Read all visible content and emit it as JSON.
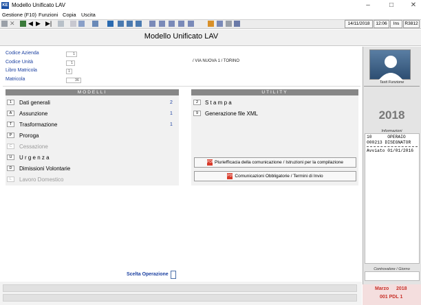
{
  "window": {
    "title": "Modello Unificato LAV",
    "icon_text": "KE"
  },
  "menu": [
    "Gestione (F10)",
    "Funzioni",
    "Copia",
    "Uscita"
  ],
  "status": {
    "date": "14/11/2018",
    "time": "12:06",
    "mode": "Ins",
    "code": "R3812"
  },
  "header": {
    "title": "Modello Unificato LAV"
  },
  "info": {
    "fields": [
      {
        "label": "Codice Azienda",
        "value": "1"
      },
      {
        "label": "Codice Unità",
        "value": "1"
      },
      {
        "label": "Libro Matricola",
        "value": "1"
      },
      {
        "label": "Matricola",
        "value": "36"
      }
    ],
    "address": "/ VIA NUOVA 1 / TORINO"
  },
  "modelli": {
    "title": "MODELLI",
    "items": [
      {
        "key": "1",
        "label": "Dati generali",
        "count": "2",
        "enabled": true
      },
      {
        "key": "A",
        "label": "Assunzione",
        "count": "1",
        "enabled": true
      },
      {
        "key": "T",
        "label": "Trasformazione",
        "count": "1",
        "enabled": true
      },
      {
        "key": "P",
        "label": "Proroga",
        "count": "",
        "enabled": true
      },
      {
        "key": "C",
        "label": "Cessazione",
        "count": "",
        "enabled": false
      },
      {
        "key": "U",
        "label": "U r g e n z a",
        "count": "",
        "enabled": true
      },
      {
        "key": "D",
        "label": "Dimissioni Volontarie",
        "count": "",
        "enabled": true
      },
      {
        "key": "L",
        "label": "Lavoro Domestico",
        "count": "",
        "enabled": false
      }
    ]
  },
  "utility": {
    "title": "UTILITY",
    "items": [
      {
        "key": "2",
        "label": "S t a m p a"
      },
      {
        "key": "9",
        "label": "Generazione file XML"
      }
    ],
    "buttons": [
      {
        "label": "Plurieffìcacia della comunicazione / Istruzioni per la compilazione"
      },
      {
        "label": "Comunicazioni Obbligatorie / Termini di Invio"
      }
    ]
  },
  "sidebar": {
    "avatar_caption": "Tasti Funzione",
    "year": "2018",
    "info_caption": "Informazioni",
    "info_lines": [
      "10      OPERAIO",
      "000213 DISEGNATOR",
      "Avviato 01/01/2016"
    ],
    "controvalore_caption": "Controvalore / Giorno",
    "month": "Marzo",
    "month_year": "2018",
    "pdl": "001 PDL 1"
  },
  "footer": {
    "scelta_label": "Scelta Operazione"
  },
  "colors": {
    "accent_blue": "#1a3fa0",
    "panel_header": "#878787",
    "date_red": "#c83028"
  }
}
